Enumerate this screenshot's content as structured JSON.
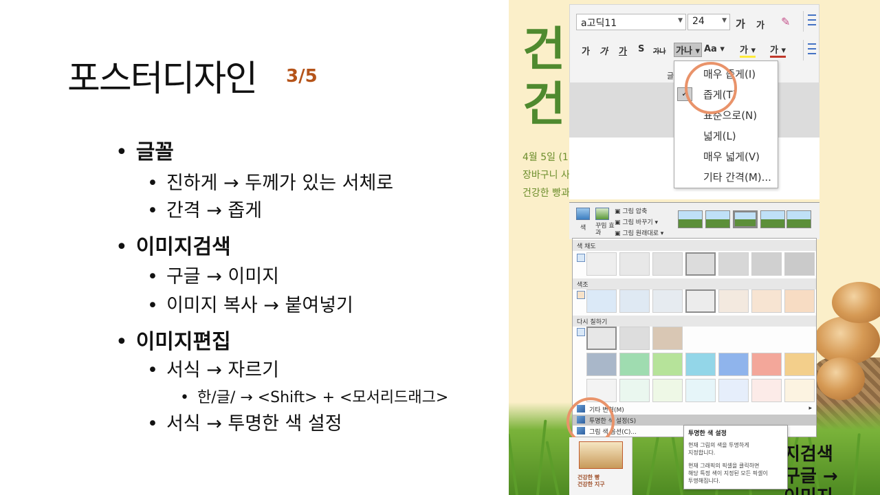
{
  "slide": {
    "title": "포스터디자인",
    "page": "3/5",
    "bullets": [
      {
        "level": 1,
        "text": "글꼴"
      },
      {
        "level": 2,
        "text": "진하게 → 두께가 있는 서체로"
      },
      {
        "level": 2,
        "text": "간격 → 좁게"
      },
      {
        "level": 1,
        "text": "이미지검색"
      },
      {
        "level": 2,
        "text": "구글 → 이미지"
      },
      {
        "level": 2,
        "text": "이미지 복사 → 붙여넣기"
      },
      {
        "level": 1,
        "text": "이미지편집"
      },
      {
        "level": 2,
        "text": "서식 → 자르기"
      },
      {
        "level": 3,
        "text": "한/글/ → <Shift> + <모서리드래그>"
      },
      {
        "level": 2,
        "text": "서식 → 투명한 색 설정"
      }
    ]
  },
  "poster": {
    "big_chars": [
      "건",
      "건"
    ],
    "lines": [
      "4월 5일 (1",
      "장바구니 사",
      "건강한 빵과"
    ],
    "side_texts": [
      "지검색",
      "구글 →",
      "이미지"
    ],
    "thumb_lines": [
      "건강한 빵",
      "건강한 지구"
    ]
  },
  "ribbon": {
    "font_name": "a고딕11",
    "font_size": "24",
    "grow_label": "가",
    "shrink_label": "가",
    "format_buttons": [
      "가",
      "가",
      "가",
      "S",
      "가나",
      "가나",
      "Aa",
      "가",
      "가"
    ],
    "spacing_menu": [
      "매우 좁게(I)",
      "좁게(T)",
      "표준으로(N)",
      "넓게(L)",
      "매우 넓게(V)",
      "기타 간격(M)..."
    ],
    "group_label": "글"
  },
  "picture_tools": {
    "color_button": "색",
    "effects_button": "꾸밈 효과",
    "compress_label": "그림 압축",
    "change_label": "그림 바꾸기",
    "reset_label": "그림 원래대로",
    "sections": [
      "색 채도",
      "색조",
      "다시 칠하기"
    ],
    "menu_items": [
      "기타 변형(M)",
      "투명한 색 설정(S)",
      "그림 색 옵션(C)..."
    ]
  },
  "tooltip": {
    "title": "투명한 색 설정",
    "lines1": [
      "현재 그림의 색을 투명하게",
      "지정합니다."
    ],
    "lines2": [
      "현재 그래픽의 픽셀을 클릭하면",
      "해당 특정 색이 지정된 모든 픽셀이",
      "투명해집니다."
    ]
  },
  "colors": {
    "accent_brown": "#b5541a",
    "poster_green": "#4f8a2f",
    "highlight_circle": "#e9936a",
    "panel_background": "#fbefc9"
  },
  "icons": [
    "gear-icon"
  ]
}
